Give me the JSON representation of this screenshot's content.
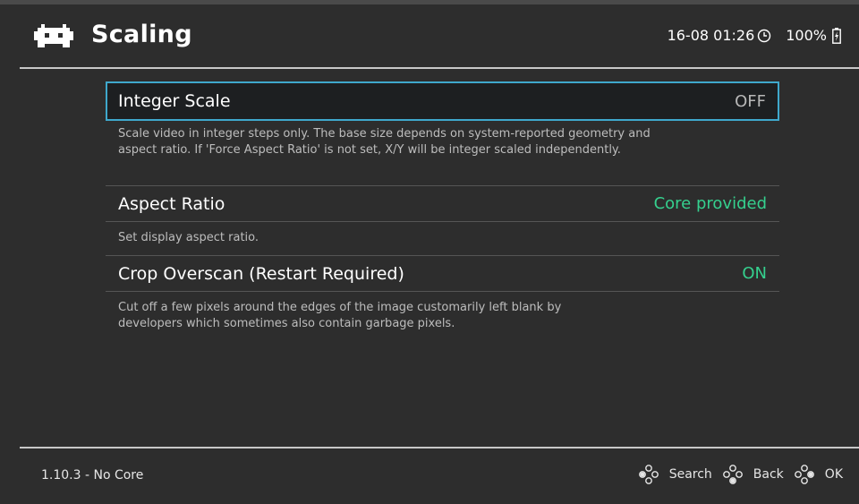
{
  "header": {
    "title": "Scaling",
    "datetime": "16-08 01:26",
    "battery": "100%",
    "logo_icon": "retroarch-invader-icon",
    "clock_icon": "clock-icon",
    "battery_icon": "battery-charging-icon"
  },
  "settings": [
    {
      "label": "Integer Scale",
      "value": "OFF",
      "description": "Scale video in integer steps only. The base size depends on system-reported geometry and aspect ratio. If 'Force Aspect Ratio' is not set, X/Y will be integer scaled independently.",
      "selected": true
    },
    {
      "label": "Aspect Ratio",
      "value": "Core provided",
      "description": "Set display aspect ratio.",
      "selected": false
    },
    {
      "label": "Crop Overscan (Restart Required)",
      "value": "ON",
      "description": "Cut off a few pixels around the edges of the image customarily left blank by developers which sometimes also contain garbage pixels.",
      "selected": false
    }
  ],
  "footer": {
    "version": "1.10.3 - No Core",
    "search_label": "Search",
    "back_label": "Back",
    "ok_label": "OK",
    "pad_icon": "gamepad-buttons-icon"
  },
  "colors": {
    "background": "#2d2d2d",
    "selection_border": "#3fa8cc",
    "value_green": "#35d08e",
    "value_off": "#b7b7b7"
  }
}
